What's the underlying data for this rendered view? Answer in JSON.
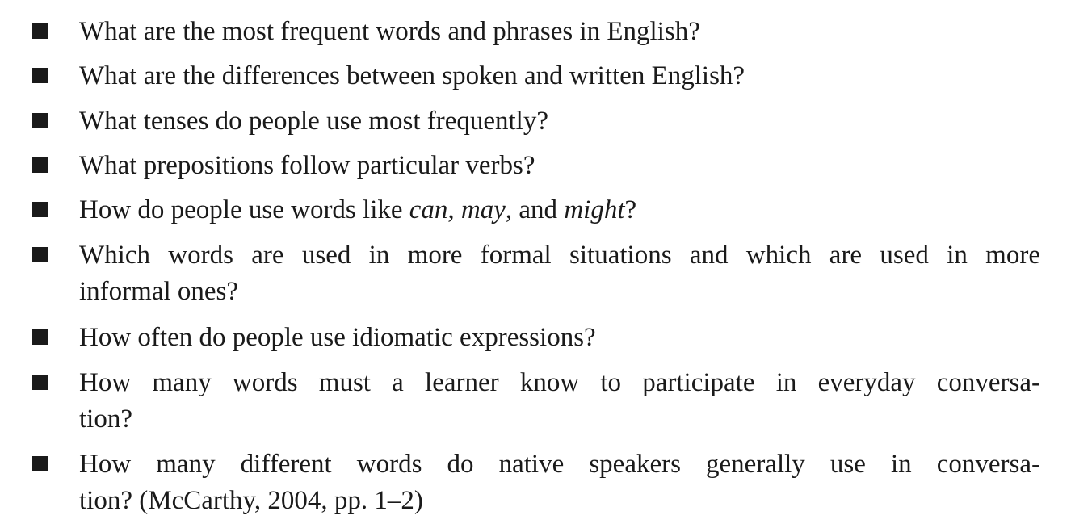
{
  "items": [
    {
      "text": "What are the most frequent words and phrases in English?"
    },
    {
      "text": "What are the differences between spoken and written English?"
    },
    {
      "text": "What tenses do people use most frequently?"
    },
    {
      "text": "What prepositions follow particular verbs?"
    },
    {
      "part1": "How do people use words like ",
      "italic1": "can, may",
      "part2": ", and ",
      "italic2": "might",
      "part3": "?"
    },
    {
      "line1": "Which words are used in more formal situations and which are used in more",
      "line2": "informal ones?"
    },
    {
      "text": "How often do people use idiomatic expressions?"
    },
    {
      "line1": "How many words must a learner know to participate in everyday conversa-",
      "line2": "tion?"
    },
    {
      "line1": "How many different words do native speakers generally use in conversa-",
      "line2": "tion? (McCarthy, 2004, pp. 1–2)"
    }
  ]
}
